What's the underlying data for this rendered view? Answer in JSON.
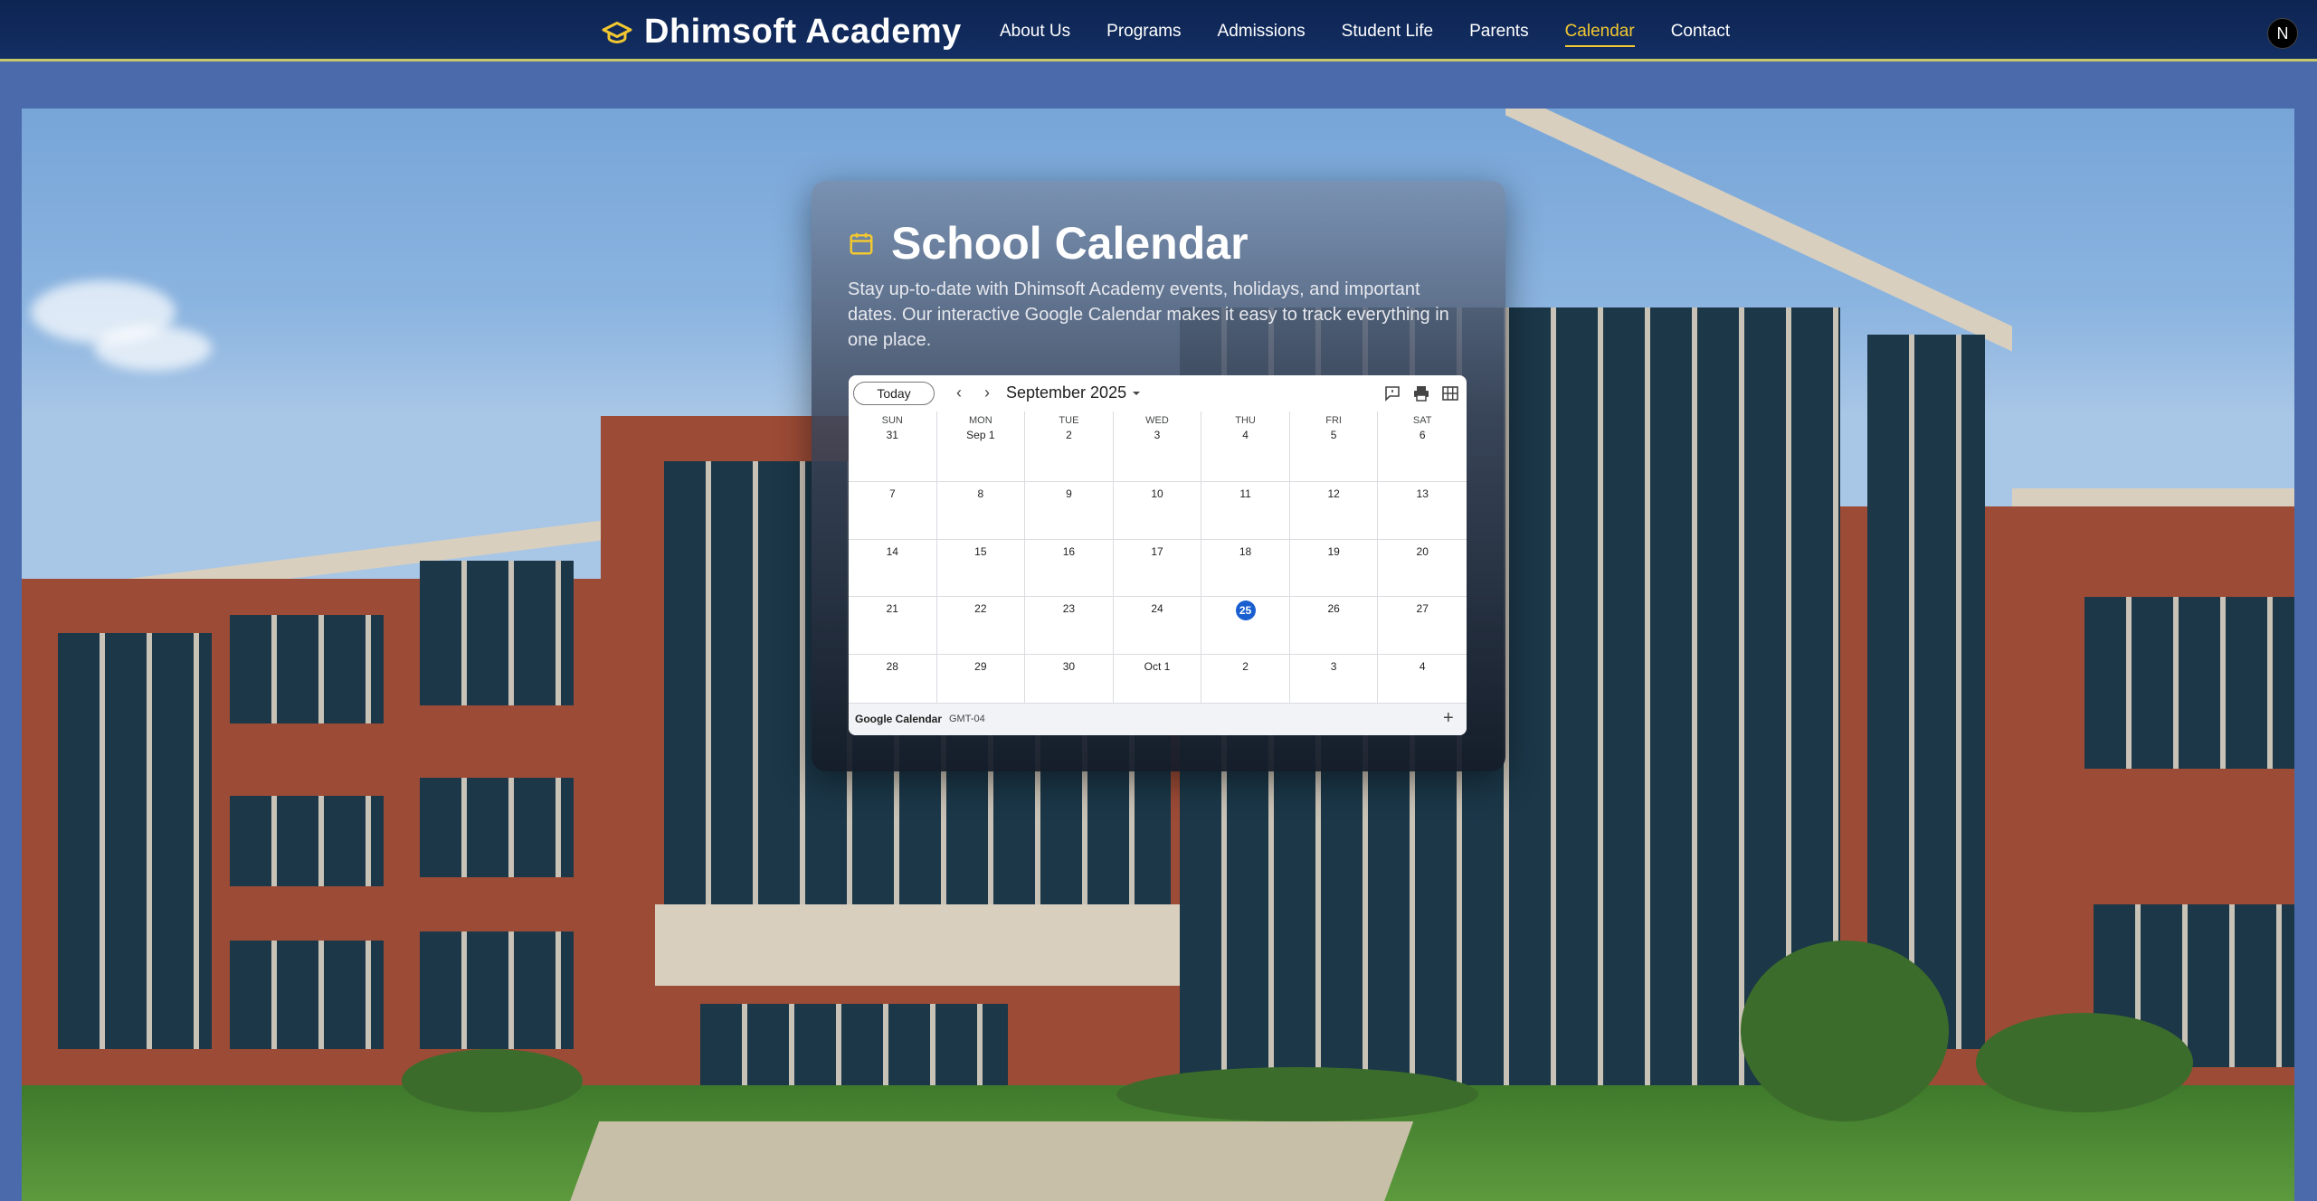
{
  "nav": {
    "brand": "Dhimsoft Academy",
    "brand_icon": "graduation-cap-icon",
    "items": [
      {
        "label": "About Us",
        "active": false
      },
      {
        "label": "Programs",
        "active": false
      },
      {
        "label": "Admissions",
        "active": false
      },
      {
        "label": "Student Life",
        "active": false
      },
      {
        "label": "Parents",
        "active": false
      },
      {
        "label": "Calendar",
        "active": true
      },
      {
        "label": "Contact",
        "active": false
      }
    ],
    "avatar_letter": "N",
    "accent_color": "#f2c830"
  },
  "card": {
    "title": "School Calendar",
    "title_icon": "calendar-icon",
    "description": "Stay up-to-date with Dhimsoft Academy events, holidays, and important dates. Our interactive Google Calendar makes it easy to track everything in one place."
  },
  "calendar": {
    "today_label": "Today",
    "month_label": "September 2025",
    "weekdays": [
      "SUN",
      "MON",
      "TUE",
      "WED",
      "THU",
      "FRI",
      "SAT"
    ],
    "weeks": [
      [
        "31",
        "Sep 1",
        "2",
        "3",
        "4",
        "5",
        "6"
      ],
      [
        "7",
        "8",
        "9",
        "10",
        "11",
        "12",
        "13"
      ],
      [
        "14",
        "15",
        "16",
        "17",
        "18",
        "19",
        "20"
      ],
      [
        "21",
        "22",
        "23",
        "24",
        "25",
        "26",
        "27"
      ],
      [
        "28",
        "29",
        "30",
        "Oct 1",
        "2",
        "3",
        "4"
      ]
    ],
    "today_date": "25",
    "footer_brand": "Google Calendar",
    "timezone": "GMT-04",
    "today_color": "#1a5fd0"
  }
}
